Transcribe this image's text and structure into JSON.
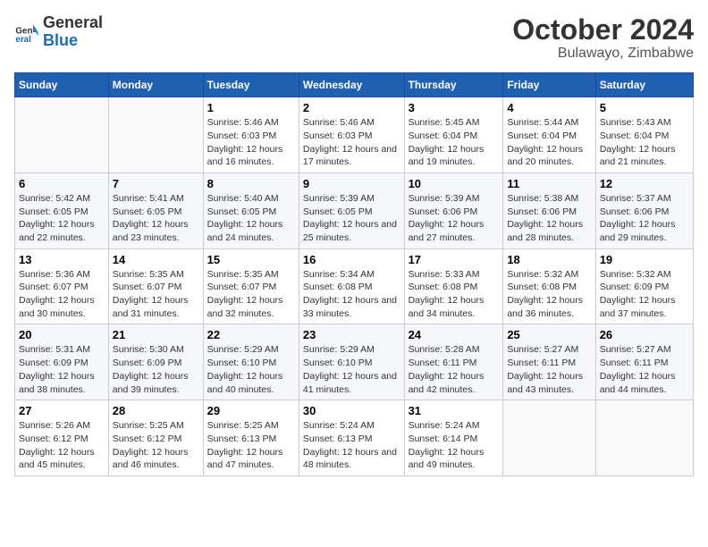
{
  "logo": {
    "text_general": "General",
    "text_blue": "Blue"
  },
  "header": {
    "month": "October 2024",
    "location": "Bulawayo, Zimbabwe"
  },
  "weekdays": [
    "Sunday",
    "Monday",
    "Tuesday",
    "Wednesday",
    "Thursday",
    "Friday",
    "Saturday"
  ],
  "weeks": [
    [
      {
        "day": "",
        "info": ""
      },
      {
        "day": "",
        "info": ""
      },
      {
        "day": "1",
        "info": "Sunrise: 5:46 AM\nSunset: 6:03 PM\nDaylight: 12 hours and 16 minutes."
      },
      {
        "day": "2",
        "info": "Sunrise: 5:46 AM\nSunset: 6:03 PM\nDaylight: 12 hours and 17 minutes."
      },
      {
        "day": "3",
        "info": "Sunrise: 5:45 AM\nSunset: 6:04 PM\nDaylight: 12 hours and 19 minutes."
      },
      {
        "day": "4",
        "info": "Sunrise: 5:44 AM\nSunset: 6:04 PM\nDaylight: 12 hours and 20 minutes."
      },
      {
        "day": "5",
        "info": "Sunrise: 5:43 AM\nSunset: 6:04 PM\nDaylight: 12 hours and 21 minutes."
      }
    ],
    [
      {
        "day": "6",
        "info": "Sunrise: 5:42 AM\nSunset: 6:05 PM\nDaylight: 12 hours and 22 minutes."
      },
      {
        "day": "7",
        "info": "Sunrise: 5:41 AM\nSunset: 6:05 PM\nDaylight: 12 hours and 23 minutes."
      },
      {
        "day": "8",
        "info": "Sunrise: 5:40 AM\nSunset: 6:05 PM\nDaylight: 12 hours and 24 minutes."
      },
      {
        "day": "9",
        "info": "Sunrise: 5:39 AM\nSunset: 6:05 PM\nDaylight: 12 hours and 25 minutes."
      },
      {
        "day": "10",
        "info": "Sunrise: 5:39 AM\nSunset: 6:06 PM\nDaylight: 12 hours and 27 minutes."
      },
      {
        "day": "11",
        "info": "Sunrise: 5:38 AM\nSunset: 6:06 PM\nDaylight: 12 hours and 28 minutes."
      },
      {
        "day": "12",
        "info": "Sunrise: 5:37 AM\nSunset: 6:06 PM\nDaylight: 12 hours and 29 minutes."
      }
    ],
    [
      {
        "day": "13",
        "info": "Sunrise: 5:36 AM\nSunset: 6:07 PM\nDaylight: 12 hours and 30 minutes."
      },
      {
        "day": "14",
        "info": "Sunrise: 5:35 AM\nSunset: 6:07 PM\nDaylight: 12 hours and 31 minutes."
      },
      {
        "day": "15",
        "info": "Sunrise: 5:35 AM\nSunset: 6:07 PM\nDaylight: 12 hours and 32 minutes."
      },
      {
        "day": "16",
        "info": "Sunrise: 5:34 AM\nSunset: 6:08 PM\nDaylight: 12 hours and 33 minutes."
      },
      {
        "day": "17",
        "info": "Sunrise: 5:33 AM\nSunset: 6:08 PM\nDaylight: 12 hours and 34 minutes."
      },
      {
        "day": "18",
        "info": "Sunrise: 5:32 AM\nSunset: 6:08 PM\nDaylight: 12 hours and 36 minutes."
      },
      {
        "day": "19",
        "info": "Sunrise: 5:32 AM\nSunset: 6:09 PM\nDaylight: 12 hours and 37 minutes."
      }
    ],
    [
      {
        "day": "20",
        "info": "Sunrise: 5:31 AM\nSunset: 6:09 PM\nDaylight: 12 hours and 38 minutes."
      },
      {
        "day": "21",
        "info": "Sunrise: 5:30 AM\nSunset: 6:09 PM\nDaylight: 12 hours and 39 minutes."
      },
      {
        "day": "22",
        "info": "Sunrise: 5:29 AM\nSunset: 6:10 PM\nDaylight: 12 hours and 40 minutes."
      },
      {
        "day": "23",
        "info": "Sunrise: 5:29 AM\nSunset: 6:10 PM\nDaylight: 12 hours and 41 minutes."
      },
      {
        "day": "24",
        "info": "Sunrise: 5:28 AM\nSunset: 6:11 PM\nDaylight: 12 hours and 42 minutes."
      },
      {
        "day": "25",
        "info": "Sunrise: 5:27 AM\nSunset: 6:11 PM\nDaylight: 12 hours and 43 minutes."
      },
      {
        "day": "26",
        "info": "Sunrise: 5:27 AM\nSunset: 6:11 PM\nDaylight: 12 hours and 44 minutes."
      }
    ],
    [
      {
        "day": "27",
        "info": "Sunrise: 5:26 AM\nSunset: 6:12 PM\nDaylight: 12 hours and 45 minutes."
      },
      {
        "day": "28",
        "info": "Sunrise: 5:25 AM\nSunset: 6:12 PM\nDaylight: 12 hours and 46 minutes."
      },
      {
        "day": "29",
        "info": "Sunrise: 5:25 AM\nSunset: 6:13 PM\nDaylight: 12 hours and 47 minutes."
      },
      {
        "day": "30",
        "info": "Sunrise: 5:24 AM\nSunset: 6:13 PM\nDaylight: 12 hours and 48 minutes."
      },
      {
        "day": "31",
        "info": "Sunrise: 5:24 AM\nSunset: 6:14 PM\nDaylight: 12 hours and 49 minutes."
      },
      {
        "day": "",
        "info": ""
      },
      {
        "day": "",
        "info": ""
      }
    ]
  ]
}
